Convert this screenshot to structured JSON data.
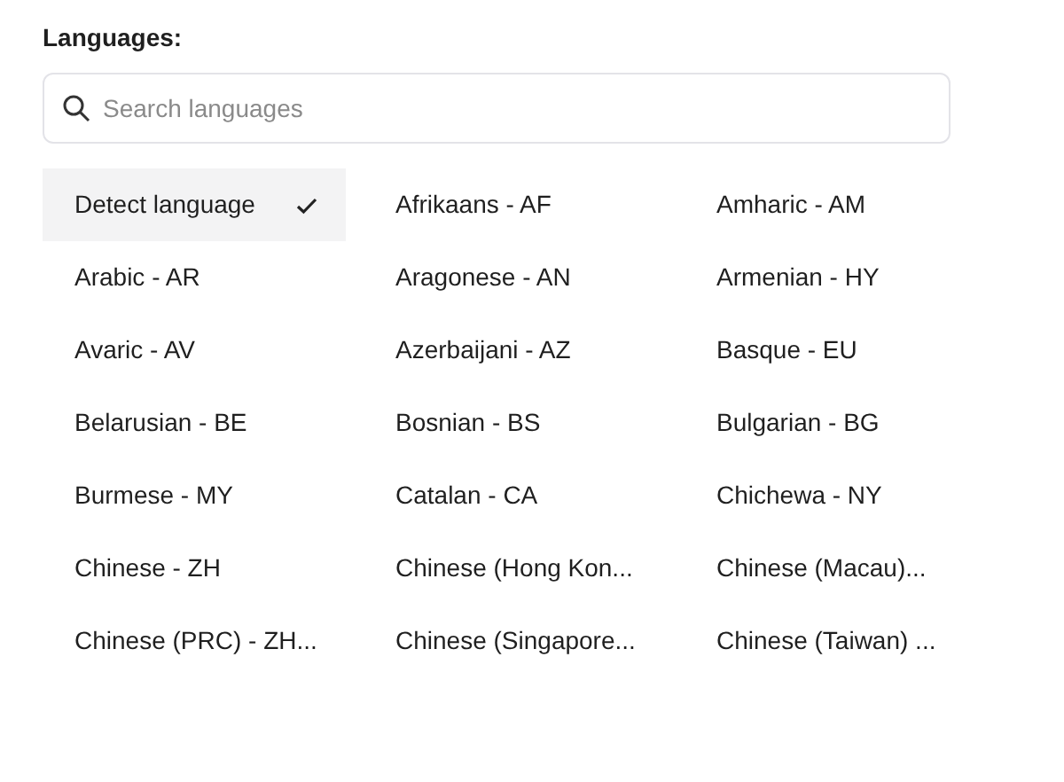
{
  "title": "Languages:",
  "search": {
    "placeholder": "Search languages"
  },
  "languages": [
    {
      "label": "Detect language",
      "selected": true
    },
    {
      "label": "Afrikaans - AF",
      "selected": false
    },
    {
      "label": "Amharic - AM",
      "selected": false
    },
    {
      "label": "Arabic - AR",
      "selected": false
    },
    {
      "label": "Aragonese - AN",
      "selected": false
    },
    {
      "label": "Armenian - HY",
      "selected": false
    },
    {
      "label": "Avaric - AV",
      "selected": false
    },
    {
      "label": "Azerbaijani - AZ",
      "selected": false
    },
    {
      "label": "Basque - EU",
      "selected": false
    },
    {
      "label": "Belarusian - BE",
      "selected": false
    },
    {
      "label": "Bosnian - BS",
      "selected": false
    },
    {
      "label": "Bulgarian - BG",
      "selected": false
    },
    {
      "label": "Burmese - MY",
      "selected": false
    },
    {
      "label": "Catalan - CA",
      "selected": false
    },
    {
      "label": "Chichewa - NY",
      "selected": false
    },
    {
      "label": "Chinese - ZH",
      "selected": false
    },
    {
      "label": "Chinese (Hong Kon...",
      "selected": false
    },
    {
      "label": "Chinese (Macau)...",
      "selected": false
    },
    {
      "label": "Chinese (PRC) - ZH...",
      "selected": false
    },
    {
      "label": "Chinese (Singapore...",
      "selected": false
    },
    {
      "label": "Chinese (Taiwan) ...",
      "selected": false
    }
  ]
}
